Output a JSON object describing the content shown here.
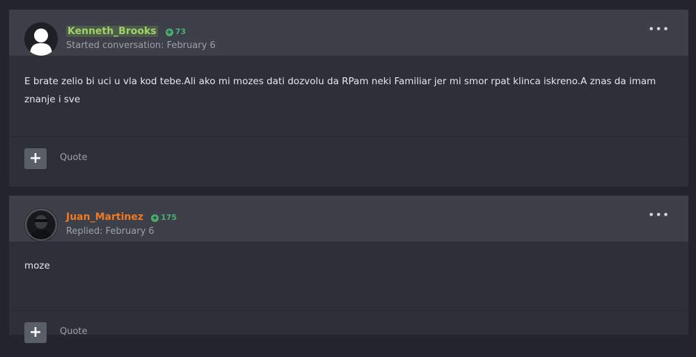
{
  "posts": [
    {
      "author": "Kenneth_Brooks",
      "reputation": "73",
      "meta": "Started conversation: February 6",
      "body": "E brate zelio bi uci u vla kod tebe.Ali ako mi mozes dati dozvolu da RPam neki Familiar jer mi smor rpat klinca iskreno.A znas da imam znanje i sve",
      "quote_label": "Quote",
      "more_label": "•••",
      "plus_label": "+",
      "name_color": "#9fd468",
      "avatar_icon": "default-user-silhouette-icon"
    },
    {
      "author": "Juan_Martinez",
      "reputation": "175",
      "meta": "Replied: February 6",
      "body": "moze",
      "quote_label": "Quote",
      "more_label": "•••",
      "plus_label": "+",
      "name_color": "#f07a23",
      "avatar_icon": "user-photo-avatar-icon"
    }
  ],
  "rep_icon": "+"
}
